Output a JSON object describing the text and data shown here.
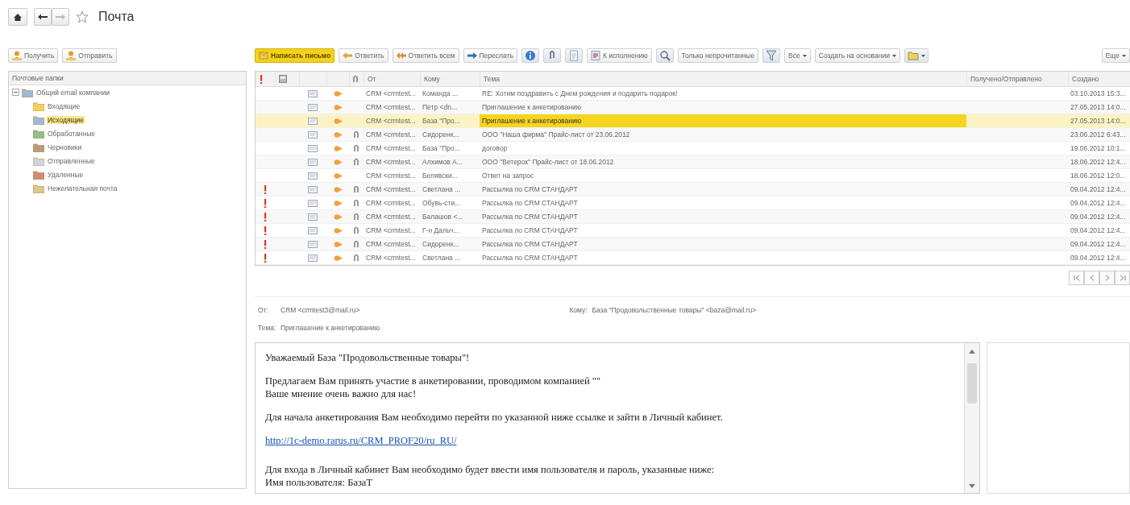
{
  "nav": {
    "title": "Почта",
    "forward_disabled": true
  },
  "folder_buttons": [
    {
      "label": "Получить"
    },
    {
      "label": "Отправить"
    }
  ],
  "toolbar": [
    {
      "kind": "icon-button",
      "label": "Написать письмо",
      "primary": true
    },
    {
      "kind": "icon-button",
      "label": "Ответить",
      "primary": false
    },
    {
      "kind": "icon-button",
      "label": "Ответить всем",
      "primary": false
    },
    {
      "kind": "icon-button",
      "label": "Переслать",
      "primary": false
    },
    {
      "kind": "icon"
    },
    {
      "kind": "icon"
    },
    {
      "kind": "icon"
    },
    {
      "kind": "icon-button",
      "label": "К исполнению",
      "primary": false
    },
    {
      "kind": "icon"
    },
    {
      "kind": "text-button",
      "label": "Только непрочитанные"
    },
    {
      "kind": "icon"
    },
    {
      "kind": "dropdown",
      "label": "Все"
    },
    {
      "kind": "dropdown",
      "label": "Создать на основании"
    },
    {
      "kind": "icon-dropdown"
    },
    {
      "kind": "dropdown",
      "label": "Еще"
    }
  ],
  "folders": {
    "title": "Почтовые папки",
    "tree": [
      {
        "label": "Общий email компании",
        "expanded": true,
        "selected": false,
        "children": [
          {
            "label": "Входящие",
            "selected": false
          },
          {
            "label": "Исходящие",
            "selected": true
          },
          {
            "label": "Обработанные",
            "selected": false
          },
          {
            "label": "Черновики",
            "selected": false
          },
          {
            "label": "Отправленные",
            "selected": false
          },
          {
            "label": "Удаленные",
            "selected": false
          },
          {
            "label": "Нежелательная почта",
            "selected": false
          }
        ]
      }
    ]
  },
  "table": {
    "columns": [
      "От",
      "Кому",
      "Тема",
      "Получено/Отправлено",
      "Создано"
    ],
    "rows": [
      {
        "important": false,
        "attachment": false,
        "from": "CRM <crmtest...",
        "to": "Команда ...",
        "subject": "RE: Хотим поздравить с Днем рождения и подарить подарок!",
        "created": "03.10.2013 15:3...",
        "selected": false
      },
      {
        "important": false,
        "attachment": false,
        "from": "CRM <crmtest...",
        "to": "Петр <dn...",
        "subject": "Приглашение к анкетированию",
        "created": "27.05.2013 14:0...",
        "selected": false
      },
      {
        "important": false,
        "attachment": false,
        "from": "CRM <crmtest...",
        "to": "База \"Про...",
        "subject": "Приглашение к анкетированию",
        "created": "27.05.2013 14:0...",
        "selected": true
      },
      {
        "important": false,
        "attachment": true,
        "from": "CRM <crmtest...",
        "to": "Сидоренк...",
        "subject": "ООО \"Наша фирма\" Прайс-лист от 23.06.2012",
        "created": "23.06.2012 6:43...",
        "selected": false
      },
      {
        "important": false,
        "attachment": true,
        "from": "CRM <crmtest...",
        "to": "База \"Про...",
        "subject": "договор",
        "created": "19.06.2012 10:1...",
        "selected": false
      },
      {
        "important": false,
        "attachment": true,
        "from": "CRM <crmtest...",
        "to": "Алхимов А...",
        "subject": "ООО \"Ветерок\" Прайс-лист от 18.06.2012",
        "created": "18.06.2012 12:4...",
        "selected": false
      },
      {
        "important": false,
        "attachment": false,
        "from": "CRM <crmtest...",
        "to": "Белявски...",
        "subject": "Ответ на запрос",
        "created": "18.06.2012 12:0...",
        "selected": false
      },
      {
        "important": true,
        "attachment": true,
        "from": "CRM <crmtest...",
        "to": "Светлана ...",
        "subject": "Рассылка по CRM СТАНДАРТ",
        "created": "09.04.2012 12:4...",
        "selected": false
      },
      {
        "important": true,
        "attachment": true,
        "from": "CRM <crmtest...",
        "to": "Обувь-сти...",
        "subject": "Рассылка по CRM СТАНДАРТ",
        "created": "09.04.2012 12:4...",
        "selected": false
      },
      {
        "important": true,
        "attachment": true,
        "from": "CRM <crmtest...",
        "to": "Балашов <...",
        "subject": "Рассылка по CRM СТАНДАРТ",
        "created": "09.04.2012 12:4...",
        "selected": false
      },
      {
        "important": true,
        "attachment": true,
        "from": "CRM <crmtest...",
        "to": "Г-н Дальч...",
        "subject": "Рассылка по CRM СТАНДАРТ",
        "created": "09.04.2012 12:4...",
        "selected": false
      },
      {
        "important": true,
        "attachment": true,
        "from": "CRM <crmtest...",
        "to": "Сидоренк...",
        "subject": "Рассылка по CRM СТАНДАРТ",
        "created": "09.04.2012 12:4...",
        "selected": false
      },
      {
        "important": true,
        "attachment": true,
        "from": "CRM <crmtest...",
        "to": "Светлана ...",
        "subject": "Рассылка по CRM СТАНДАРТ",
        "created": "09.04.2012 12:4...",
        "selected": false
      }
    ]
  },
  "preview": {
    "from_label": "От:",
    "from": "CRM <crmtest3@mail.ru>",
    "to_label": "Кому:",
    "to": "База \"Продовольственные товары\" <baza@mail.ru>",
    "subject_label": "Тема:",
    "subject": "Приглашение к анкетированию",
    "body": [
      {
        "kind": "text",
        "lines": [
          "Уважаемый База \"Продовольственные товары\"!"
        ]
      },
      {
        "kind": "text",
        "lines": [
          "Предлагаем Вам принять участие в анкетировании, проводимом компанией \"\"",
          "Ваше мнение очень важно для нас!"
        ]
      },
      {
        "kind": "text",
        "lines": [
          "Для начала анкетирования Вам необходимо перейти по указанной ниже ссылке и зайти в Личный кабинет."
        ]
      },
      {
        "kind": "link",
        "text": "http://1c-demo.rarus.ru/CRM_PROF20/ru_RU/"
      },
      {
        "kind": "text",
        "lines": [
          "Для входа в Личный кабинет Вам необходимо будет ввести имя пользователя и пароль, указанные ниже:",
          "Имя пользователя: БазаТ"
        ]
      }
    ]
  }
}
